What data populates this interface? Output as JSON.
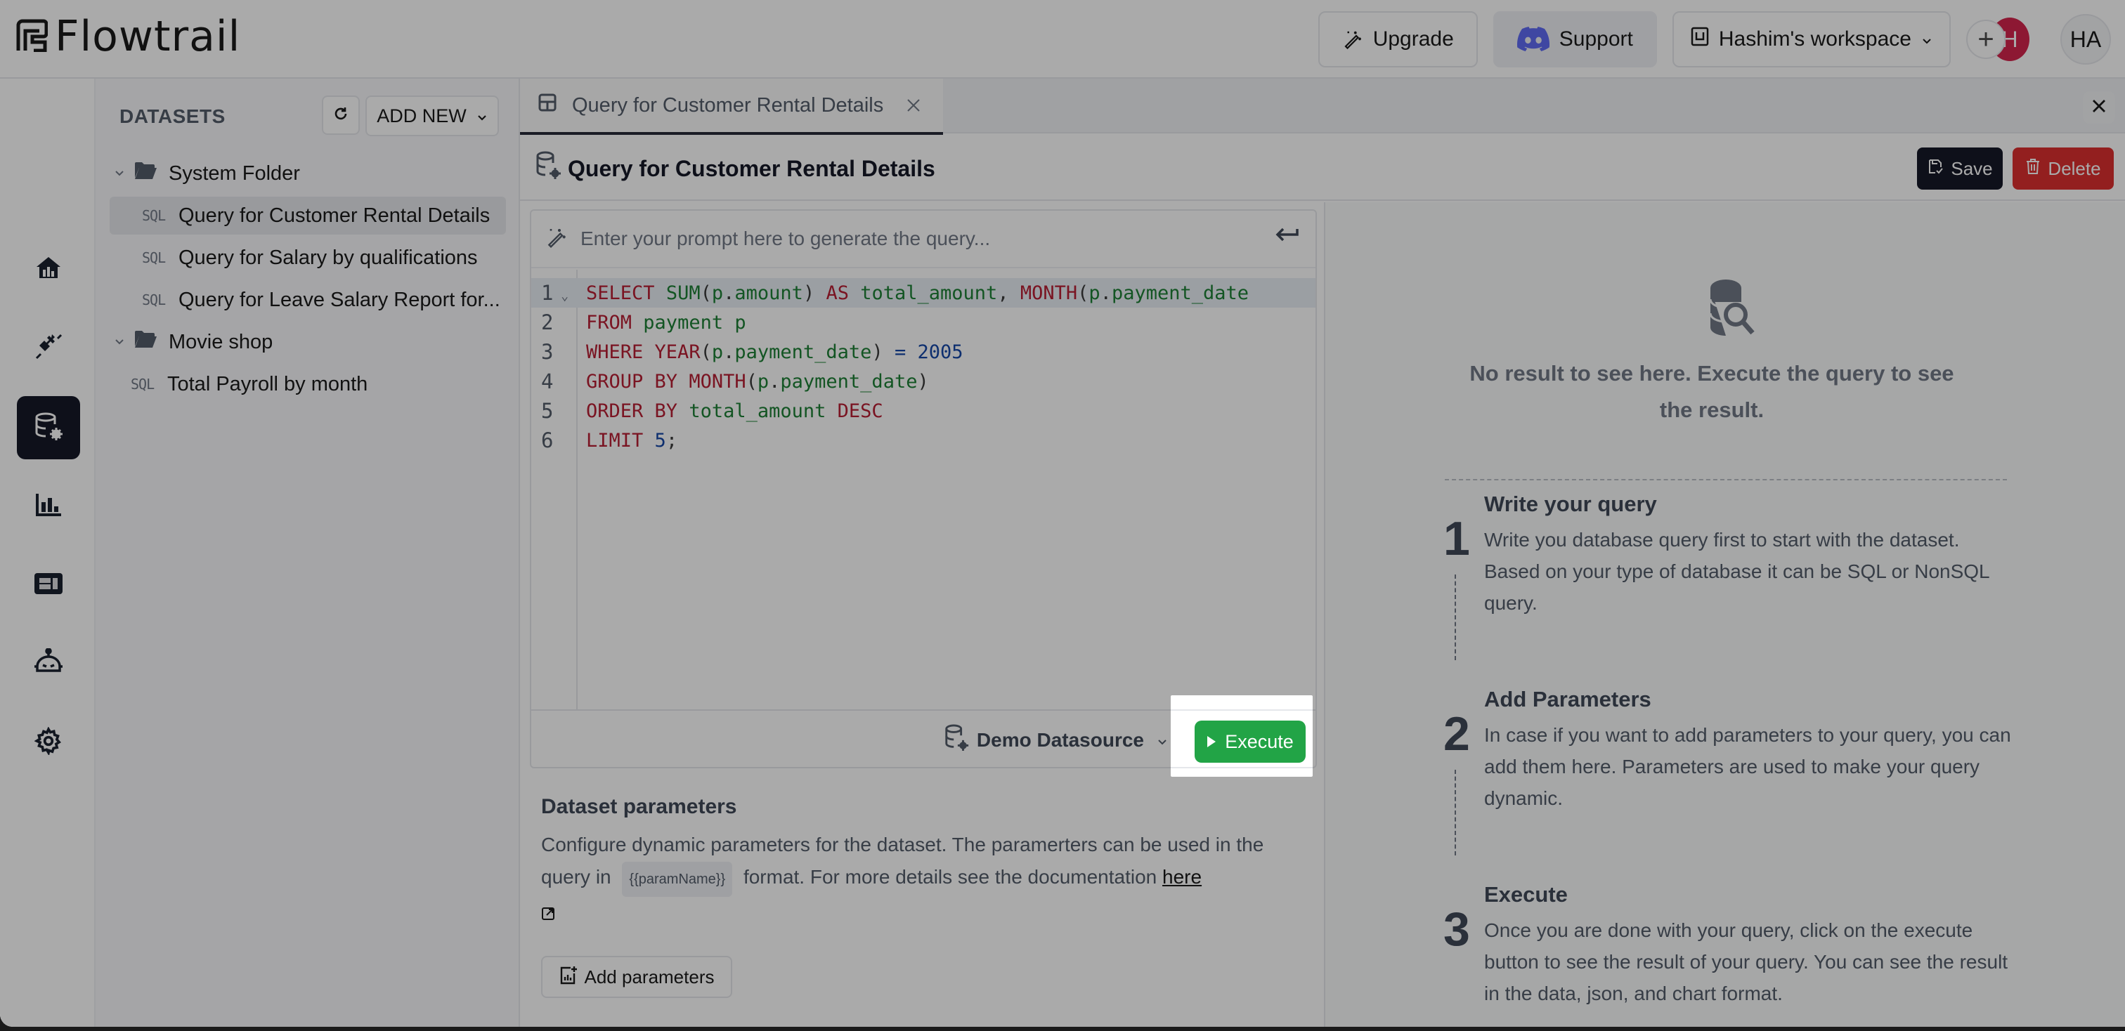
{
  "app": {
    "brand_name": "Flowtrail"
  },
  "topbar": {
    "upgrade_label": "Upgrade",
    "support_label": "Support",
    "workspace_label": "Hashim's workspace",
    "avatar_plus": "+",
    "avatar_h": "H",
    "user_initials": "HA",
    "discord_color": "#5865F2"
  },
  "leftnav": {
    "items": [
      {
        "name": "home",
        "icon": "home-chart-icon"
      },
      {
        "name": "connections",
        "icon": "plug-icon"
      },
      {
        "name": "datasets",
        "icon": "database-gear-icon",
        "active": true
      },
      {
        "name": "charts",
        "icon": "bar-chart-icon"
      },
      {
        "name": "dashboards",
        "icon": "dashboard-icon"
      },
      {
        "name": "ai-assistant",
        "icon": "robot-icon"
      },
      {
        "name": "settings",
        "icon": "gear-icon"
      }
    ]
  },
  "datasets_panel": {
    "title": "DATASETS",
    "add_new_label": "ADD NEW",
    "sql_tag": "SQL",
    "folders": [
      {
        "name": "System Folder",
        "expanded": true,
        "items": [
          {
            "label": "Query for Customer Rental Details",
            "selected": true
          },
          {
            "label": "Query for Salary by qualifications"
          },
          {
            "label": "Query for Leave Salary Report for..."
          }
        ]
      },
      {
        "name": "Movie shop",
        "expanded": true,
        "items": []
      }
    ],
    "root_items": [
      {
        "label": "Total Payroll by month"
      }
    ]
  },
  "tabs": [
    {
      "label": "Query for Customer Rental Details",
      "active": true
    }
  ],
  "dataset": {
    "title": "Query for Customer Rental Details",
    "save_label": "Save",
    "delete_label": "Delete"
  },
  "editor": {
    "prompt_placeholder": "Enter your prompt here to generate the query...",
    "lines": [
      {
        "n": "1",
        "text": "SELECT SUM(p.amount) AS total_amount, MONTH(p.payment_date"
      },
      {
        "n": "2",
        "text": "FROM payment p"
      },
      {
        "n": "3",
        "text": "WHERE YEAR(p.payment_date) = 2005"
      },
      {
        "n": "4",
        "text": "GROUP BY MONTH(p.payment_date)"
      },
      {
        "n": "5",
        "text": "ORDER BY total_amount DESC"
      },
      {
        "n": "6",
        "text": "LIMIT 5;"
      }
    ],
    "datasource_label": "Demo Datasource",
    "execute_label": "Execute"
  },
  "params": {
    "title": "Dataset parameters",
    "desc_1": "Configure dynamic parameters for the dataset. The paramerters can be used in the query in",
    "chip": "{{paramName}}",
    "desc_2": "format. For more details see the documentation",
    "link_label": "here",
    "add_label": "Add parameters"
  },
  "result": {
    "empty_message": "No result to see here. Execute the query to see the result.",
    "steps": [
      {
        "num": "1",
        "title": "Write your query",
        "body": "Write you database query first to start with the dataset. Based on your type of database it can be SQL or NonSQL query."
      },
      {
        "num": "2",
        "title": "Add Parameters",
        "body": "In case if you want to add parameters to your query, you can add them here. Parameters are used to make your query dynamic."
      },
      {
        "num": "3",
        "title": "Execute",
        "body": "Once you are done with your query, click on the execute button to see the result of your query. You can see the result in the data, json, and chart format."
      }
    ]
  },
  "colors": {
    "primary_dark": "#0b0f1e",
    "execute_green": "#22a446",
    "delete_red": "#dc2626",
    "avatar_red": "#d21c45"
  }
}
